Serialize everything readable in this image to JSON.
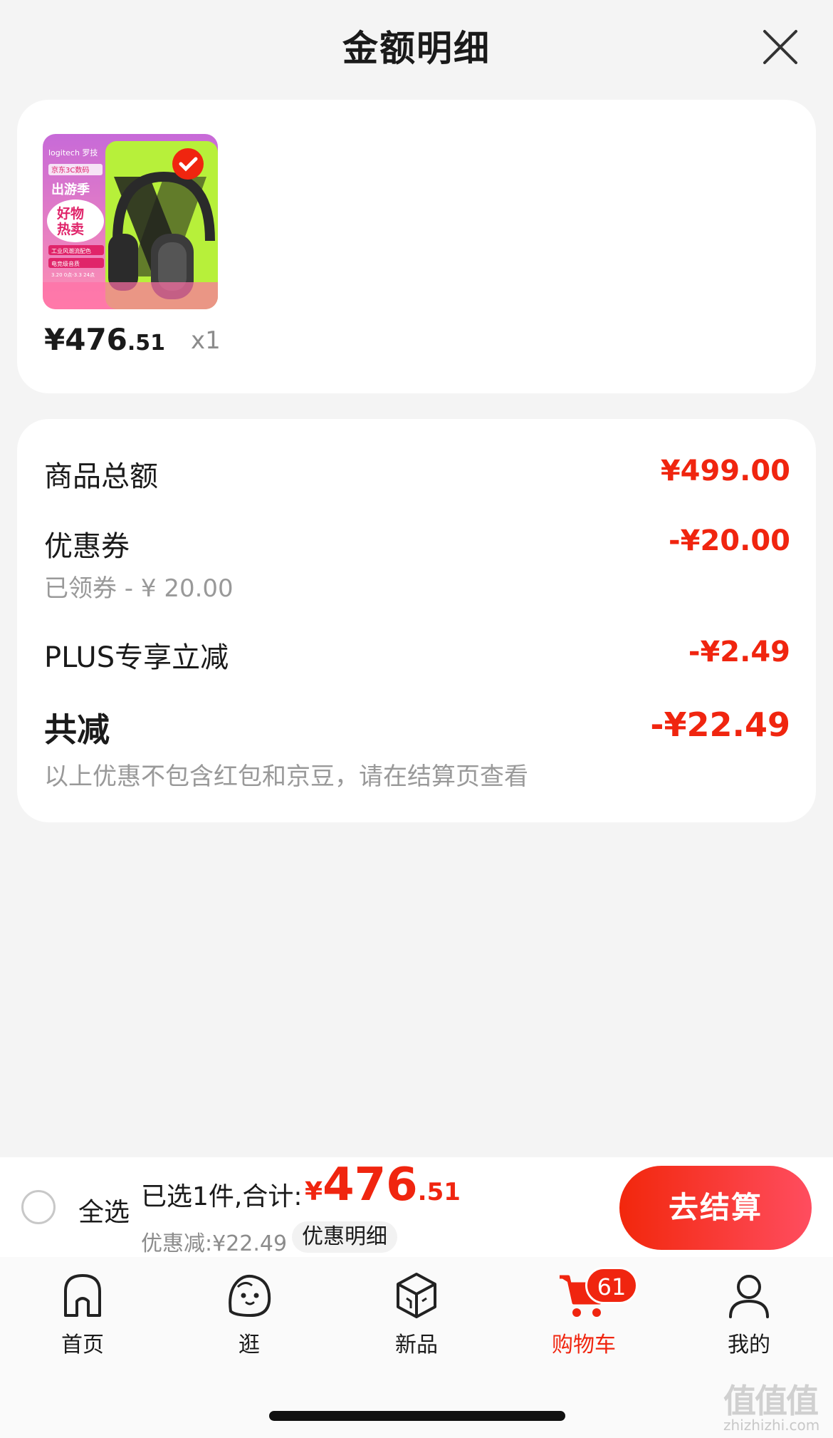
{
  "header": {
    "title": "金额明细",
    "close_icon": "close-icon"
  },
  "product": {
    "thumbnail": {
      "brand_text": "logitech 罗技",
      "tag_text": "京东3C数码",
      "promo_text": "出游季",
      "headline_1": "好物",
      "headline_2": "热卖",
      "line_1": "工业风潮流配色",
      "line_2": "电竞级音质",
      "date_text": "3.20 0点-3.3 24点"
    },
    "price_int": "¥476",
    "price_dec": ".51",
    "quantity": "x1"
  },
  "details": {
    "subtotal_label": "商品总额",
    "subtotal_value": "¥499.00",
    "coupon_label": "优惠券",
    "coupon_value": "-¥20.00",
    "coupon_sub": "已领券 - ¥ 20.00",
    "plus_label": "PLUS专享立减",
    "plus_value": "-¥2.49",
    "total_label": "共减",
    "total_value": "-¥22.49",
    "note": "以上优惠不包含红包和京豆，请在结算页查看"
  },
  "bottom_bar": {
    "select_all": "全选",
    "selected_text": "已选1件,合计:",
    "total_symbol": "¥",
    "total_int": "476",
    "total_dec": ".51",
    "discount_text": "优惠减:¥22.49",
    "detail_chip": "优惠明细",
    "checkout": "去结算"
  },
  "tabbar": {
    "tabs": [
      {
        "label": "首页",
        "icon": "home-icon"
      },
      {
        "label": "逛",
        "icon": "browse-icon"
      },
      {
        "label": "新品",
        "icon": "new-products-icon"
      },
      {
        "label": "购物车",
        "icon": "cart-icon",
        "badge": "61",
        "active": true
      },
      {
        "label": "我的",
        "icon": "profile-icon"
      }
    ]
  },
  "watermark": {
    "text": "值值值",
    "url": "zhizhizhi.com"
  },
  "colors": {
    "accent": "#f0250f",
    "background": "#f4f4f4"
  }
}
